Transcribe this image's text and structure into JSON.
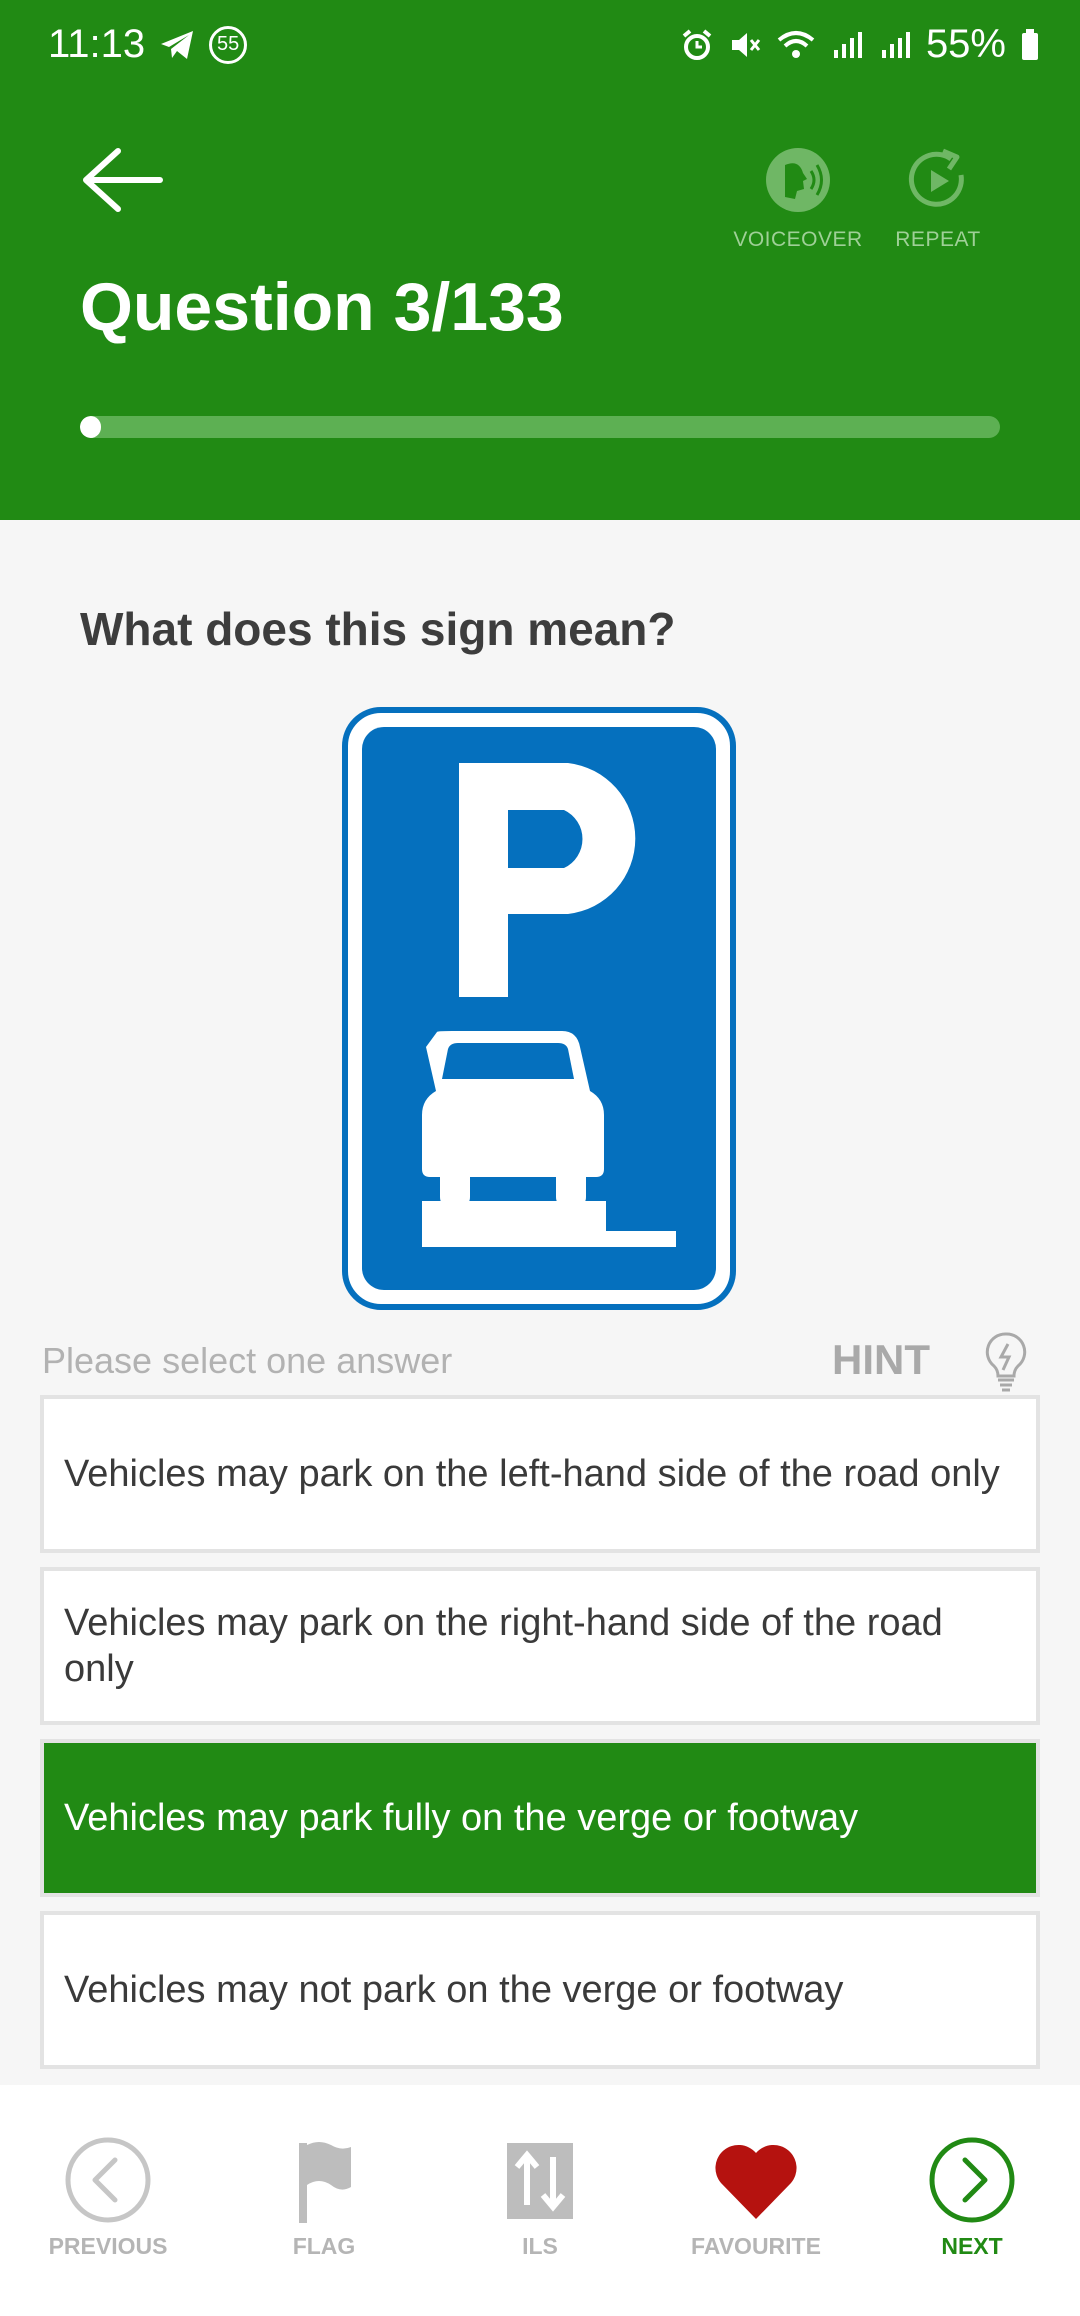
{
  "status_bar": {
    "time": "11:13",
    "notification_count": "55",
    "battery": "55%"
  },
  "header": {
    "title": "Question 3/133",
    "voiceover_label": "VOICEOVER",
    "repeat_label": "REPEAT",
    "progress_fraction": 0.023
  },
  "question": {
    "text": "What does this sign mean?",
    "sign_icon": "parking-on-verge-sign",
    "select_prompt": "Please select one answer",
    "hint_label": "HINT"
  },
  "answers": [
    {
      "text": "Vehicles may park on the left-hand side of the road only",
      "selected": false
    },
    {
      "text": "Vehicles may park on the right-hand side of the road only",
      "selected": false
    },
    {
      "text": "Vehicles may park fully on the verge or footway",
      "selected": true
    },
    {
      "text": "Vehicles may not park on the verge or footway",
      "selected": false
    }
  ],
  "bottom_nav": {
    "previous": "PREVIOUS",
    "flag": "FLAG",
    "ils": "ILS",
    "favourite": "FAVOURITE",
    "next": "NEXT"
  },
  "colors": {
    "accent": "#218a14",
    "sign_blue": "#0570be",
    "favourite_red": "#b5120f"
  }
}
